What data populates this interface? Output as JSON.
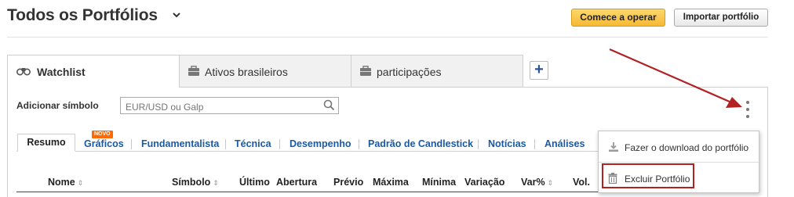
{
  "header": {
    "title": "Todos os Portfólios",
    "start_trading": "Comece a operar",
    "import_portfolio": "Importar portfólio"
  },
  "tabs": [
    {
      "label": "Watchlist",
      "icon": "binoculars-icon",
      "active": true
    },
    {
      "label": "Ativos brasileiros",
      "icon": "briefcase-icon",
      "active": false
    },
    {
      "label": "participações",
      "icon": "briefcase-icon",
      "active": false
    }
  ],
  "add_tab": "+",
  "toolbar": {
    "add_symbol_label": "Adicionar símbolo",
    "search_placeholder": "EUR/USD ou Galp"
  },
  "subtabs": {
    "items": [
      "Resumo",
      "Gráficos",
      "Fundamentalista",
      "Técnica",
      "Desempenho",
      "Padrão de Candlestick",
      "Notícias",
      "Análises"
    ],
    "badge": "NOVO"
  },
  "columns": [
    "Nome",
    "Símbolo",
    "Último",
    "Abertura",
    "Prévio",
    "Máxima",
    "Mínima",
    "Variação",
    "Var%",
    "Vol."
  ],
  "menu": {
    "download": "Fazer o download do portfólio",
    "delete": "Excluir Portfólio"
  },
  "colors": {
    "accent_button": "#f7b935",
    "link_blue": "#1a5aa5",
    "annotation_red": "#b22222"
  }
}
